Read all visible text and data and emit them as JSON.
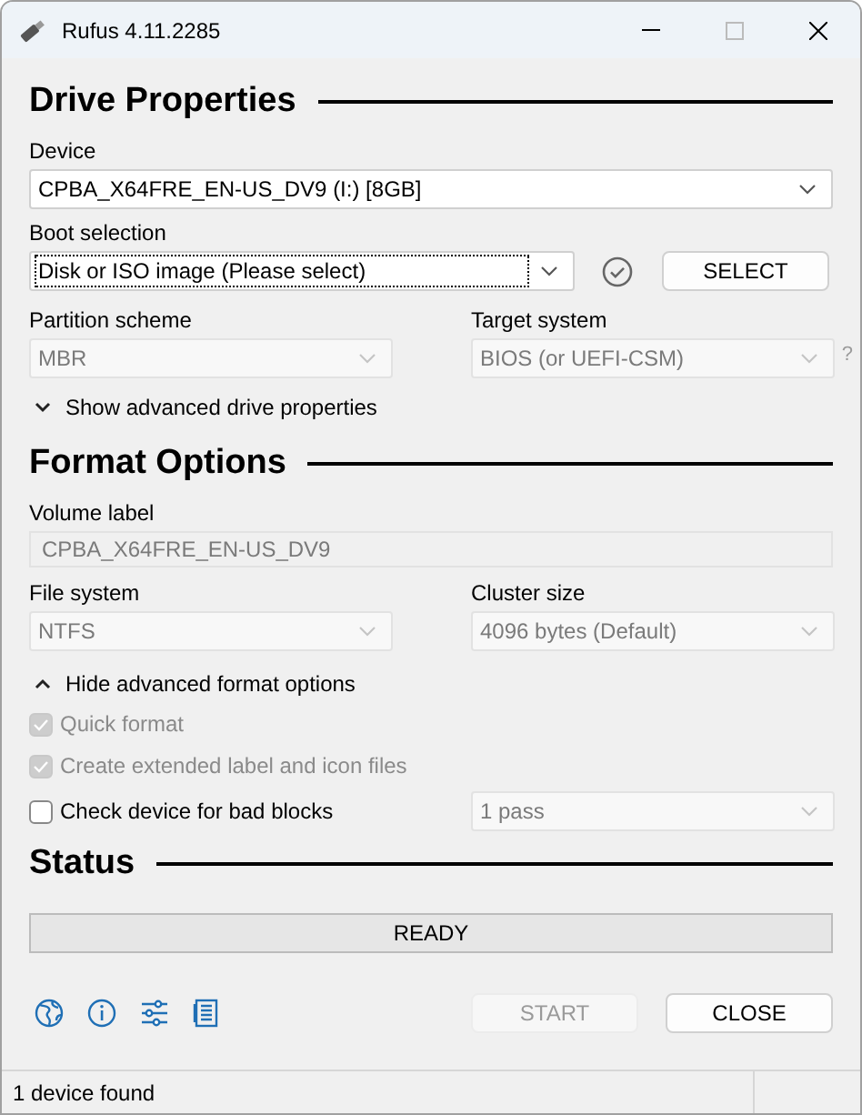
{
  "window": {
    "title": "Rufus 4.11.2285"
  },
  "drive_properties": {
    "heading": "Drive Properties",
    "device": {
      "label": "Device",
      "value": "CPBA_X64FRE_EN-US_DV9 (I:) [8GB]",
      "disabled": false
    },
    "boot_selection": {
      "label": "Boot selection",
      "value": "Disk or ISO image (Please select)",
      "disabled": false,
      "focused": true
    },
    "select_button": {
      "label": "SELECT",
      "disabled": false
    },
    "partition_scheme": {
      "label": "Partition scheme",
      "value": "MBR",
      "disabled": true
    },
    "target_system": {
      "label": "Target system",
      "value": "BIOS (or UEFI-CSM)",
      "disabled": true
    },
    "help_mark": "?",
    "advanced_toggle": {
      "label": "Show advanced drive properties",
      "expanded": false
    }
  },
  "format_options": {
    "heading": "Format Options",
    "volume_label": {
      "label": "Volume label",
      "value": "CPBA_X64FRE_EN-US_DV9",
      "disabled": true
    },
    "file_system": {
      "label": "File system",
      "value": "NTFS",
      "disabled": true
    },
    "cluster_size": {
      "label": "Cluster size",
      "value": "4096 bytes (Default)",
      "disabled": true
    },
    "advanced_toggle": {
      "label": "Hide advanced format options",
      "expanded": true
    },
    "checkboxes": [
      {
        "label": "Quick format",
        "checked": true,
        "disabled": true
      },
      {
        "label": "Create extended label and icon files",
        "checked": true,
        "disabled": true
      },
      {
        "label": "Check device for bad blocks",
        "checked": false,
        "disabled": false
      }
    ],
    "passes": {
      "value": "1 pass",
      "disabled": true
    }
  },
  "status": {
    "heading": "Status",
    "progress": {
      "text": "READY",
      "level": 0
    }
  },
  "buttons": [
    {
      "label": "START",
      "disabled": true
    },
    {
      "label": "CLOSE",
      "disabled": false
    }
  ],
  "status_bar": {
    "text": "1 device found"
  }
}
